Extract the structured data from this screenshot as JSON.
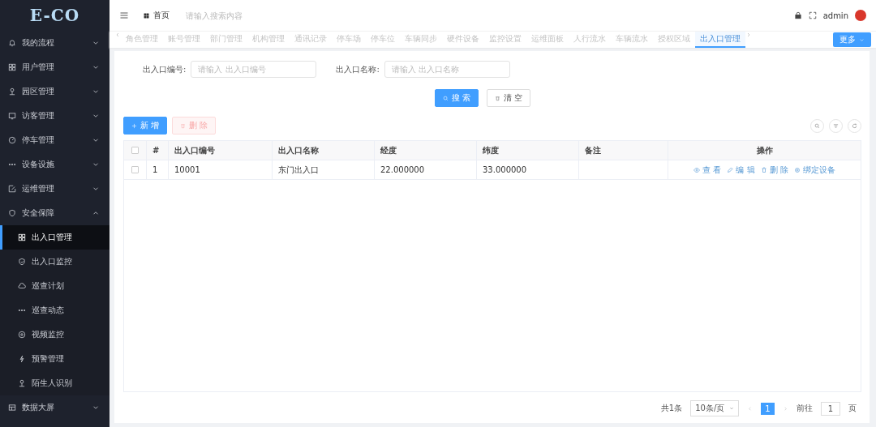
{
  "logo": {
    "text": "E-CO"
  },
  "sidebar": {
    "items": [
      {
        "label": "我的流程",
        "expanded": false,
        "selected": false
      },
      {
        "label": "用户管理",
        "expanded": false,
        "selected": false
      },
      {
        "label": "园区管理",
        "expanded": false,
        "selected": false
      },
      {
        "label": "访客管理",
        "expanded": false,
        "selected": false
      },
      {
        "label": "停车管理",
        "expanded": false,
        "selected": false
      },
      {
        "label": "设备设施",
        "expanded": false,
        "selected": false
      },
      {
        "label": "运维管理",
        "expanded": false,
        "selected": false
      },
      {
        "label": "安全保障",
        "expanded": true,
        "selected": false,
        "children": [
          {
            "label": "出入口管理",
            "selected": true
          },
          {
            "label": "出入口监控",
            "selected": false
          },
          {
            "label": "巡查计划",
            "selected": false
          },
          {
            "label": "巡查动态",
            "selected": false
          },
          {
            "label": "视频监控",
            "selected": false
          },
          {
            "label": "预警管理",
            "selected": false
          },
          {
            "label": "陌生人识别",
            "selected": false
          }
        ]
      },
      {
        "label": "数据大屏",
        "expanded": false,
        "selected": false
      }
    ]
  },
  "header": {
    "breadcrumb": "首页",
    "search": {
      "placeholder": "请输入搜索内容"
    },
    "user": "admin"
  },
  "tabs": [
    {
      "label": "角色管理",
      "selected": false
    },
    {
      "label": "账号管理",
      "selected": false
    },
    {
      "label": "部门管理",
      "selected": false
    },
    {
      "label": "机构管理",
      "selected": false
    },
    {
      "label": "通讯记录",
      "selected": false
    },
    {
      "label": "停车场",
      "selected": false
    },
    {
      "label": "停车位",
      "selected": false
    },
    {
      "label": "车辆同步",
      "selected": false
    },
    {
      "label": "硬件设备",
      "selected": false
    },
    {
      "label": "监控设置",
      "selected": false
    },
    {
      "label": "运维面板",
      "selected": false
    },
    {
      "label": "人行流水",
      "selected": false
    },
    {
      "label": "车辆流水",
      "selected": false
    },
    {
      "label": "授权区域",
      "selected": false
    },
    {
      "label": "出入口管理",
      "selected": true
    }
  ],
  "more_button": "更多",
  "filters": [
    {
      "label": "出入口编号:",
      "placeholder": "请输入 出入口编号"
    },
    {
      "label": "出入口名称:",
      "placeholder": "请输入 出入口名称"
    }
  ],
  "search_buttons": [
    {
      "label": "搜 索",
      "kind": "primary"
    },
    {
      "label": "清 空",
      "kind": "plain"
    }
  ],
  "toolbar_buttons": [
    {
      "label": "新 增",
      "kind": "add"
    },
    {
      "label": "删 除",
      "kind": "delete",
      "disabled": true
    }
  ],
  "table": {
    "all_checked": false,
    "columns": [
      "#",
      "出入口编号",
      "出入口名称",
      "经度",
      "纬度",
      "备注",
      "操作"
    ],
    "rows": [
      {
        "checked": false,
        "cells": [
          "1",
          "10001",
          "东门出入口",
          "22.000000",
          "33.000000"
        ],
        "actions": [
          "查 看",
          "编 辑",
          "删 除",
          "绑定设备"
        ]
      }
    ]
  },
  "pagination": {
    "total": "共1条",
    "page_size": "10条/页",
    "current": "1",
    "goto_label": "前往",
    "goto_value": "1",
    "page_suffix": "页"
  }
}
